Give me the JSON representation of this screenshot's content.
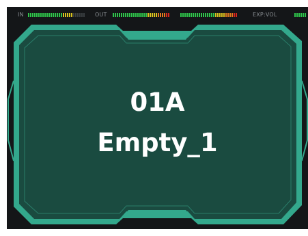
{
  "meters": {
    "in_label": "IN",
    "out_label": "OUT",
    "exp_label": "EXP:VOL",
    "in_level": 0.8,
    "out_level": 1.0,
    "out2_level": 1.0,
    "exp_level": 1.0
  },
  "colors": {
    "screen_bg": "#141618",
    "panel_bg": "#1a4b40",
    "frame_accent": "#33a88c",
    "frame_line": "#5fd3b4",
    "meter_green": "#2ec44a",
    "meter_yellow": "#d8c21f",
    "meter_orange": "#e07a1f",
    "meter_red": "#d9261c",
    "meter_off": "#3a3f42",
    "text": "#ffffff"
  },
  "preset": {
    "number": "01A",
    "name": "Empty_1"
  }
}
